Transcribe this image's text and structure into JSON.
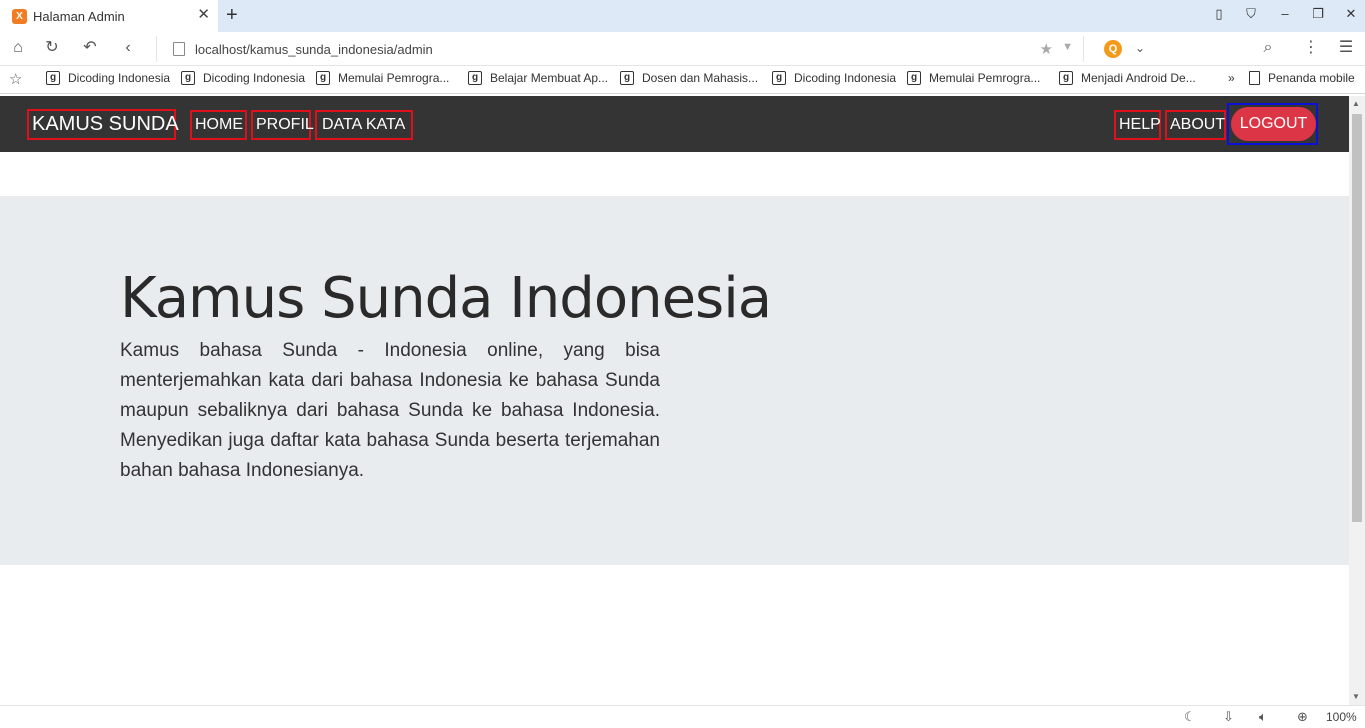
{
  "browser": {
    "tab_title": "Halaman Admin",
    "tab_favicon": "X",
    "address": "localhost/kamus_sunda_indonesia/admin",
    "search_engine_letter": "Q",
    "zoom": "100%",
    "bookmarks": [
      "Dicoding Indonesia",
      "Dicoding Indonesia",
      "Memulai Pemrogra...",
      "Belajar Membuat Ap...",
      "Dosen dan Mahasis...",
      "Dicoding Indonesia",
      "Memulai Pemrogra...",
      "Menjadi Android De..."
    ],
    "bookmarks_overflow": "»",
    "bookmarks_mobile": "Penanda mobile"
  },
  "navbar": {
    "brand": "KAMUS SUNDA",
    "left_items": [
      "HOME",
      "PROFIL",
      "DATA KATA"
    ],
    "right_items": [
      "HELP",
      "ABOUT"
    ],
    "logout": "LOGOUT"
  },
  "jumbotron": {
    "title": "Kamus Sunda Indonesia",
    "lead": "Kamus bahasa Sunda - Indonesia online, yang bisa menterjemahkan kata dari bahasa Indonesia ke bahasa Sunda maupun sebaliknya dari bahasa Sunda ke bahasa Indonesia. Menyedikan juga daftar kata bahasa Sunda beserta terjemahan bahan bahasa Indonesianya."
  },
  "colors": {
    "navbar_bg": "#343434",
    "highlight_border": "#e0101a",
    "logout_bg": "#dc3545",
    "logout_border": "#0b12d6",
    "jumbotron_bg": "#e9ecef"
  }
}
